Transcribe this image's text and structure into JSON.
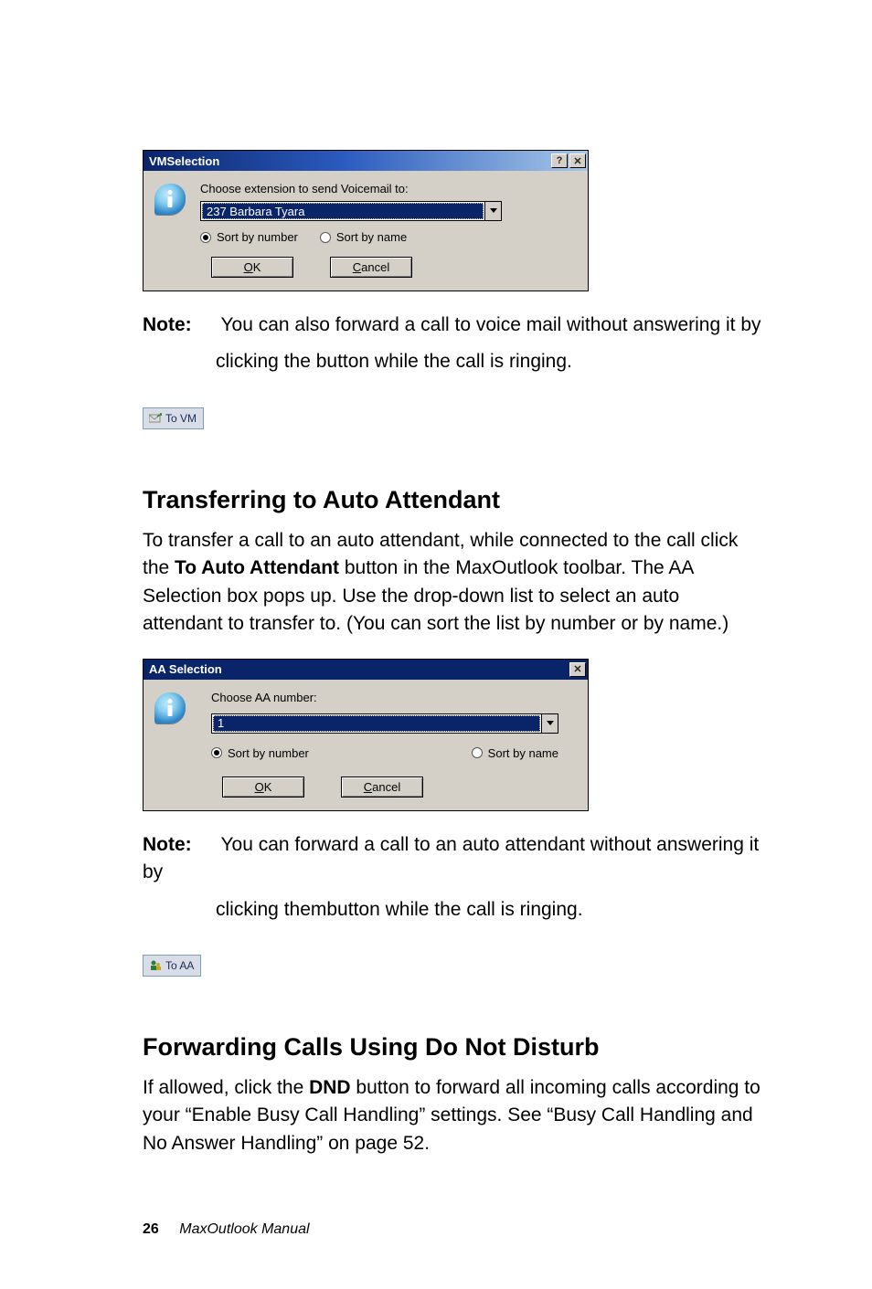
{
  "vm_dialog": {
    "title": "VMSelection",
    "help_btn": "?",
    "close_btn": "✕",
    "prompt": "Choose extension to send Voicemail to:",
    "combo_value": "237 Barbara Tyara",
    "sort_number": "Sort by number",
    "sort_name": "Sort by name",
    "ok_pre": "O",
    "ok_u": "K",
    "cancel_u": "C",
    "cancel_post": "ancel"
  },
  "note1": {
    "label": "Note:",
    "line1": "You can also forward a call to voice mail without answering it by",
    "line2": "clicking the button while the call is ringing."
  },
  "tovm_btn": {
    "label": "To VM"
  },
  "heading_aa": "Transferring to Auto Attendant",
  "para_aa_1": "To transfer a call to an auto attendant, while connected to the call click the ",
  "para_aa_bold": "To Auto Attendant",
  "para_aa_2": " button in the MaxOutlook toolbar. The AA Selection box pops up. Use the drop-down list to select an auto attendant to transfer to. (You can sort the list by number or by name.)",
  "aa_dialog": {
    "title": "AA Selection",
    "close_btn": "✕",
    "prompt": "Choose AA number:",
    "combo_value": "1",
    "sort_number": "Sort by number",
    "sort_name": "Sort by name",
    "ok_pre": "O",
    "ok_u": "K",
    "cancel_u": "C",
    "cancel_post": "ancel"
  },
  "note2": {
    "label": "Note:",
    "line1": "You can forward a call to an auto attendant without answering it by",
    "line2": "clicking thembutton while the call is ringing."
  },
  "toaa_btn": {
    "label": "To AA"
  },
  "heading_dnd": "Forwarding Calls Using Do Not Disturb",
  "para_dnd_1": "If allowed, click the ",
  "para_dnd_bold": "DND",
  "para_dnd_2": " button to forward all incoming calls according to your “Enable Busy Call Handling” settings. See “Busy Call Handling and No Answer Handling” on page 52.",
  "footer": {
    "page": "26",
    "book": "MaxOutlook Manual"
  }
}
